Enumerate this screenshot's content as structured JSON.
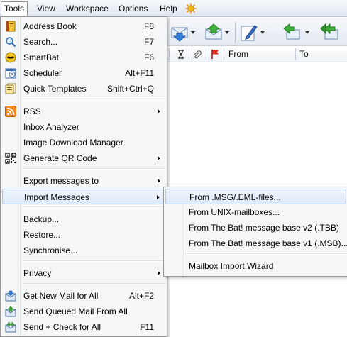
{
  "menubar": {
    "items": [
      {
        "label": "Tools"
      },
      {
        "label": "View"
      },
      {
        "label": "Workspace"
      },
      {
        "label": "Options"
      },
      {
        "label": "Help"
      }
    ],
    "extra_icon": "gear-sun-icon"
  },
  "list_header": {
    "from": "From",
    "to": "To",
    "icons": [
      "hourglass-icon",
      "paperclip-icon",
      "flag-icon"
    ]
  },
  "toolbar": {
    "icons": [
      "download-mail-icon",
      "upload-mail-icon",
      "compose-icon",
      "reply-icon",
      "reply-all-icon"
    ]
  },
  "tools_menu": {
    "items": [
      {
        "label": "Address Book",
        "shortcut": "F8",
        "icon": "address-book-icon"
      },
      {
        "label": "Search...",
        "shortcut": "F7",
        "icon": "search-icon"
      },
      {
        "label": "SmartBat",
        "shortcut": "F6",
        "icon": "smartbat-icon"
      },
      {
        "label": "Scheduler",
        "shortcut": "Alt+F11",
        "icon": "scheduler-icon"
      },
      {
        "label": "Quick Templates",
        "shortcut": "Shift+Ctrl+Q",
        "icon": "quick-templates-icon"
      },
      {
        "label": "RSS",
        "icon": "rss-icon"
      },
      {
        "label": "Inbox Analyzer"
      },
      {
        "label": "Image Download Manager"
      },
      {
        "label": "Generate QR Code",
        "icon": "qr-code-icon"
      },
      {
        "label": "Export messages to"
      },
      {
        "label": "Import Messages"
      },
      {
        "label": "Backup..."
      },
      {
        "label": "Restore..."
      },
      {
        "label": "Synchronise..."
      },
      {
        "label": "Privacy"
      },
      {
        "label": "Get New Mail for All",
        "shortcut": "Alt+F2",
        "icon": "get-mail-icon"
      },
      {
        "label": "Send Queued Mail From All",
        "icon": "send-mail-icon"
      },
      {
        "label": "Send + Check for All",
        "shortcut": "F11",
        "icon": "send-check-icon"
      }
    ]
  },
  "import_submenu": {
    "items": [
      {
        "label": "From .MSG/.EML-files..."
      },
      {
        "label": "From UNIX-mailboxes..."
      },
      {
        "label": "From The Bat! message base v2 (.TBB)"
      },
      {
        "label": "From The Bat! message base v1 (.MSB)..."
      },
      {
        "label": "Mailbox Import Wizard"
      }
    ]
  }
}
